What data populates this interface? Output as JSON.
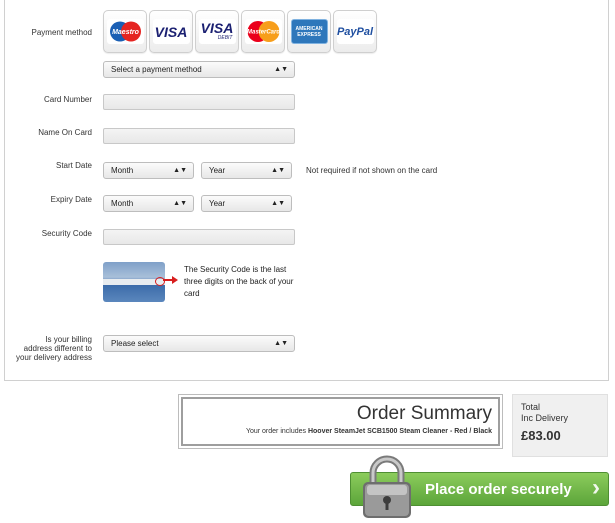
{
  "payment": {
    "label": "Payment method",
    "cards": [
      {
        "name": "Maestro",
        "icon": "maestro-card-icon"
      },
      {
        "name": "VISA",
        "icon": "visa-card-icon"
      },
      {
        "name": "VISA",
        "sub": "DEBIT",
        "icon": "visa-debit-card-icon"
      },
      {
        "name": "MasterCard",
        "icon": "mastercard-card-icon"
      },
      {
        "name": "AMERICAN EXPRESS",
        "icon": "amex-card-icon"
      },
      {
        "name": "PayPal",
        "icon": "paypal-icon"
      }
    ],
    "select_value": "Select a payment method"
  },
  "card_number": {
    "label": "Card Number",
    "value": ""
  },
  "name_on_card": {
    "label": "Name On Card",
    "value": ""
  },
  "start_date": {
    "label": "Start Date",
    "month": "Month",
    "year": "Year",
    "note": "Not required if not shown on the card"
  },
  "expiry_date": {
    "label": "Expiry Date",
    "month": "Month",
    "year": "Year"
  },
  "security_code": {
    "label": "Security Code",
    "value": "",
    "help": "The Security Code is the last three digits on the back of your card"
  },
  "billing": {
    "label_lines": [
      "Is your billing",
      "address different to",
      "your delivery address"
    ],
    "select_value": "Please select"
  },
  "summary": {
    "title": "Order Summary",
    "prefix": "Your order includes ",
    "product": "Hoover SteamJet SCB1500 Steam Cleaner - Red / Black"
  },
  "total": {
    "line1": "Total",
    "line2": "Inc Delivery",
    "amount": "£83.00"
  },
  "order_button": {
    "label": "Place order securely",
    "chevron": "›"
  },
  "colors": {
    "button_green": "#6cb545",
    "accent_red": "#d81e1e"
  }
}
